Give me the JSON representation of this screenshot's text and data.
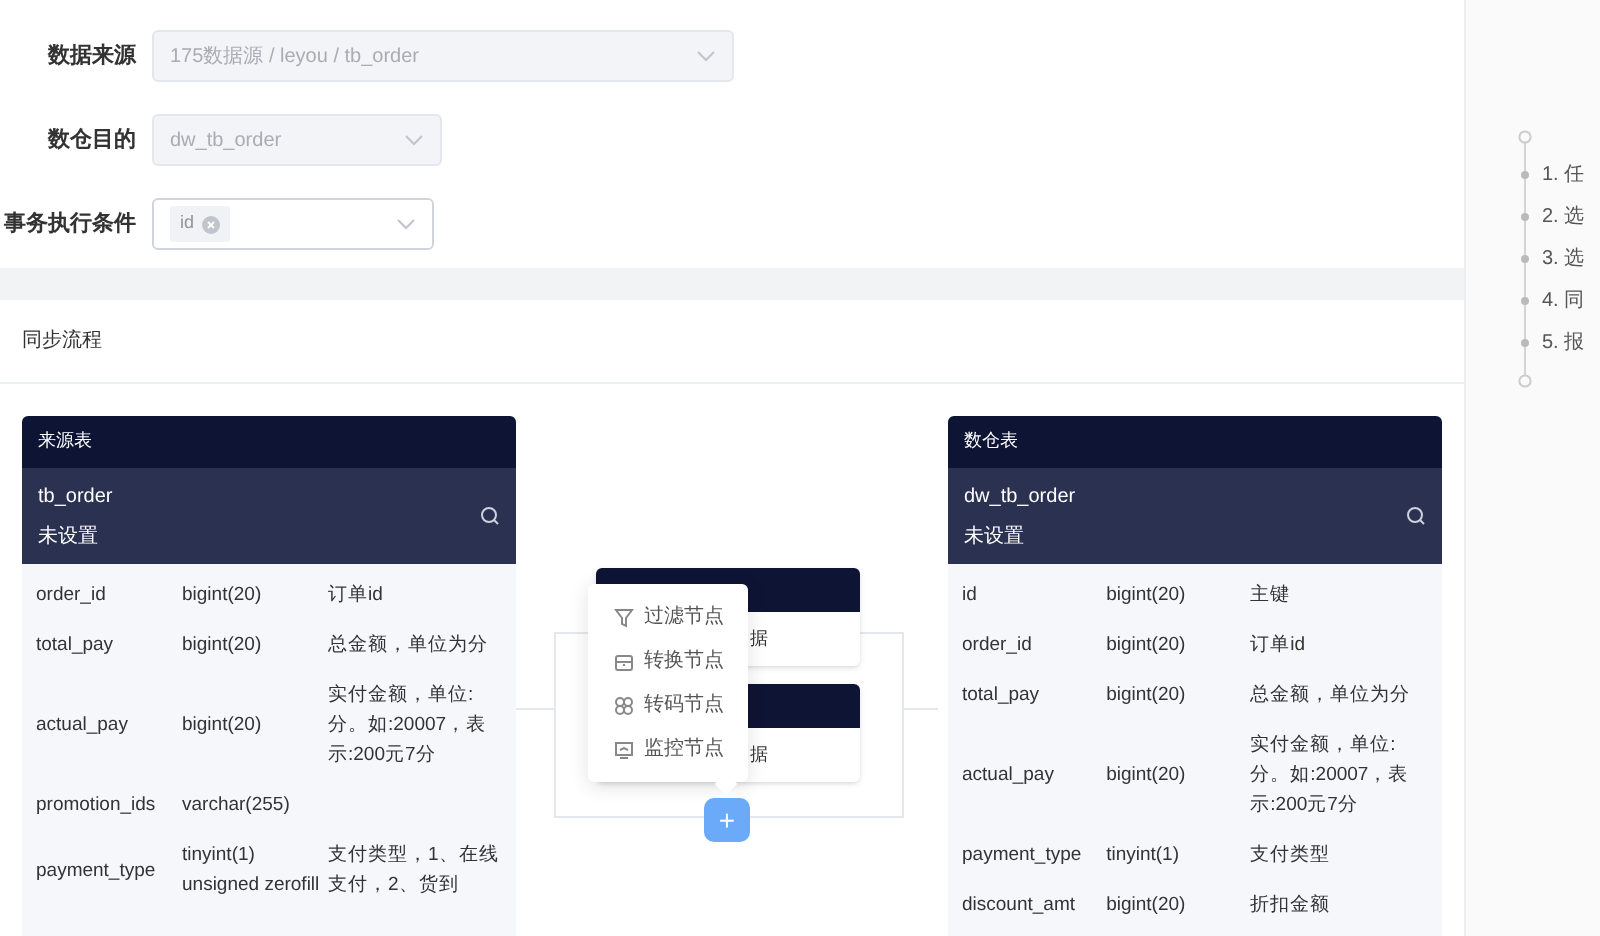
{
  "form": {
    "fields": [
      {
        "label": "数据来源",
        "value": "175数据源 / leyou / tb_order",
        "disabled": true,
        "kind": "select"
      },
      {
        "label": "数仓目的",
        "value": "dw_tb_order",
        "disabled": true,
        "kind": "select"
      },
      {
        "label": "事务执行条件",
        "tags": [
          "id"
        ],
        "disabled": false,
        "kind": "multiselect"
      }
    ]
  },
  "flow": {
    "title": "同步流程",
    "source": {
      "title": "来源表",
      "table": "tb_order",
      "status": "未设置",
      "rows": [
        {
          "name": "order_id",
          "type": "bigint(20)",
          "comment": "订单id"
        },
        {
          "name": "total_pay",
          "type": "bigint(20)",
          "comment": "总金额，单位为分"
        },
        {
          "name": "actual_pay",
          "type": "bigint(20)",
          "comment": "实付金额，单位:分。如:20007，表示:200元7分"
        },
        {
          "name": "promotion_ids",
          "type": "varchar(255)",
          "comment": ""
        },
        {
          "name": "payment_type",
          "type": "tinyint(1) unsigned zerofill",
          "comment": "支付类型，1、在线支付，2、货到"
        }
      ]
    },
    "nodes": [
      {
        "body": "据"
      },
      {
        "body": "据"
      }
    ],
    "menu": [
      {
        "label": "过滤节点",
        "kind": "filter"
      },
      {
        "label": "转换节点",
        "kind": "convert"
      },
      {
        "label": "转码节点",
        "kind": "code"
      },
      {
        "label": "监控节点",
        "kind": "monitor"
      }
    ],
    "add_button": "+",
    "target": {
      "title": "数仓表",
      "table": "dw_tb_order",
      "status": "未设置",
      "rows": [
        {
          "name": "id",
          "type": "bigint(20)",
          "comment": "主键"
        },
        {
          "name": "order_id",
          "type": "bigint(20)",
          "comment": "订单id"
        },
        {
          "name": "total_pay",
          "type": "bigint(20)",
          "comment": "总金额，单位为分"
        },
        {
          "name": "actual_pay",
          "type": "bigint(20)",
          "comment": "实付金额，单位:分。如:20007，表示:200元7分"
        },
        {
          "name": "payment_type",
          "type": "tinyint(1)",
          "comment": "支付类型"
        },
        {
          "name": "discount_amt",
          "type": "bigint(20)",
          "comment": "折扣金额"
        }
      ]
    }
  },
  "steps": [
    {
      "label": "1. 任"
    },
    {
      "label": "2. 选"
    },
    {
      "label": "3. 选"
    },
    {
      "label": "4. 同"
    },
    {
      "label": "5. 报"
    }
  ]
}
